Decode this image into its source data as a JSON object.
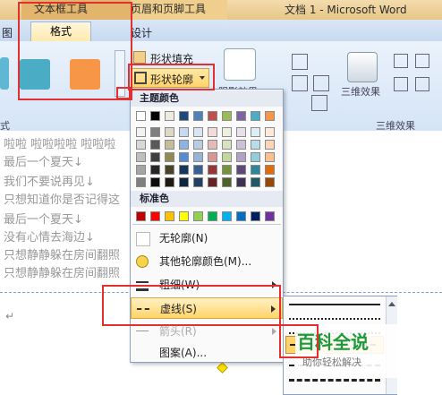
{
  "titlebar": {
    "context_tab_1": "文本框工具",
    "context_tab_2": "页眉和页脚工具",
    "doc_title": "文档 1 - Microsoft Word"
  },
  "tabs": {
    "left_partial": "图",
    "active": "格式",
    "right_partial": "设计"
  },
  "ribbon": {
    "fill_button": "形状填充",
    "outline_button": "形状轮廓",
    "effects_partial": "阴影效果",
    "threed_button": "三维效果",
    "threed_group": "三维效果",
    "left_group_partial": "式"
  },
  "document": {
    "lines": [
      "啦啦 啦啦啦啦 啦啦啦",
      "最后一个夏天↓",
      "我们不要说再见↓",
      "只想知道你是否记得这",
      "最后一个夏天↓",
      "没有心情去海边↓",
      "只想静静躲在房间翻照",
      "只想静静躲在房间翻照"
    ],
    "cursor_mark": "↵"
  },
  "menu": {
    "theme_header": "主题颜色",
    "standard_header": "标准色",
    "theme_colors": [
      "#ffffff",
      "#000000",
      "#eeece1",
      "#1f497d",
      "#4f81bd",
      "#c0504d",
      "#9bbb59",
      "#8064a2",
      "#4bacc6",
      "#f79646"
    ],
    "theme_shades": [
      [
        "#f2f2f2",
        "#7f7f7f",
        "#ddd9c3",
        "#c6d9f0",
        "#dbe5f1",
        "#f2dcdb",
        "#ebf1dd",
        "#e5e0ec",
        "#dbeef3",
        "#fdeada"
      ],
      [
        "#d8d8d8",
        "#595959",
        "#c4bd97",
        "#8db3e2",
        "#b8cce4",
        "#e5b9b7",
        "#d7e3bc",
        "#ccc1d9",
        "#b7dde8",
        "#fbd5b5"
      ],
      [
        "#bfbfbf",
        "#3f3f3f",
        "#938953",
        "#548dd4",
        "#95b3d7",
        "#d99694",
        "#c3d69b",
        "#b2a2c7",
        "#92cddc",
        "#fac08f"
      ],
      [
        "#a5a5a5",
        "#262626",
        "#494429",
        "#17365d",
        "#366092",
        "#953734",
        "#76923c",
        "#5f497a",
        "#31859b",
        "#e36c09"
      ],
      [
        "#7f7f7f",
        "#0c0c0c",
        "#1d1b10",
        "#0f243e",
        "#244061",
        "#632423",
        "#4f6128",
        "#3f3151",
        "#205867",
        "#974806"
      ]
    ],
    "standard_colors": [
      "#c00000",
      "#ff0000",
      "#ffc000",
      "#ffff00",
      "#92d050",
      "#00b050",
      "#00b0f0",
      "#0070c0",
      "#002060",
      "#7030a0"
    ],
    "items": {
      "no_outline": "无轮廓(N)",
      "more_colors": "其他轮廓颜色(M)...",
      "weight": "粗细(W)",
      "dashes": "虚线(S)",
      "arrows": "箭头(R)",
      "pattern": "图案(A)..."
    }
  },
  "watermark": {
    "title": "百科全说",
    "subtitle": "助你轻松解决"
  },
  "colors": {
    "highlight_red": "#e23030",
    "style_blue": "#4bacc6",
    "style_orange": "#f79646"
  }
}
